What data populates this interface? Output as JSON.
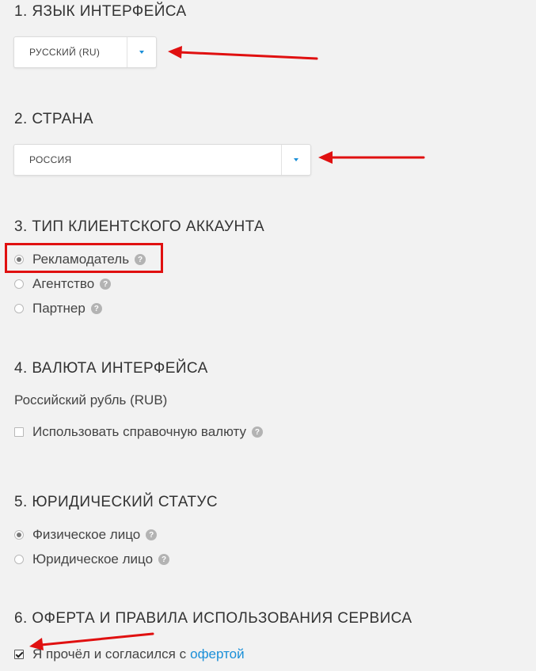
{
  "colors": {
    "accent": "#1a8fd8",
    "annotation": "#e01010"
  },
  "icons": {
    "help": "question-mark-circle-icon",
    "dropdown": "caret-down-icon"
  },
  "section1": {
    "title": "1. ЯЗЫК ИНТЕРФЕЙСА",
    "select_value": "РУССКИЙ (RU)"
  },
  "section2": {
    "title": "2. СТРАНА",
    "select_value": "РОССИЯ"
  },
  "section3": {
    "title": "3. ТИП КЛИЕНТСКОГО АККАУНТА",
    "options": [
      {
        "label": "Рекламодатель",
        "selected": true
      },
      {
        "label": "Агентство",
        "selected": false
      },
      {
        "label": "Партнер",
        "selected": false
      }
    ],
    "help_glyph": "?"
  },
  "section4": {
    "title": "4. ВАЛЮТА ИНТЕРФЕЙСА",
    "currency": "Российский рубль (RUB)",
    "checkbox_label": "Использовать справочную валюту",
    "checkbox_checked": false
  },
  "section5": {
    "title": "5. ЮРИДИЧЕСКИЙ СТАТУС",
    "options": [
      {
        "label": "Физическое лицо",
        "selected": true
      },
      {
        "label": "Юридическое лицо",
        "selected": false
      }
    ]
  },
  "section6": {
    "title": "6. ОФЕРТА И ПРАВИЛА ИСПОЛЬЗОВАНИЯ СЕРВИСА",
    "agree_text": "Я прочёл и согласился с",
    "agree_link": "офертой",
    "checkbox_checked": true
  }
}
